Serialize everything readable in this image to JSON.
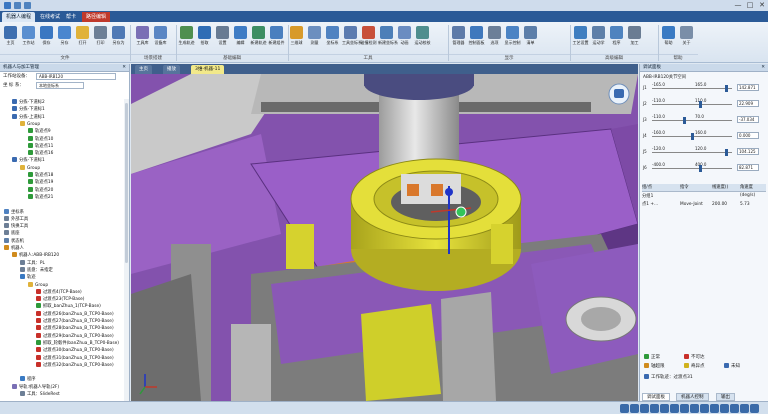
{
  "window": {
    "quick_access": [
      "save",
      "undo",
      "redo"
    ],
    "controls": [
      "—",
      "□",
      "✕"
    ]
  },
  "ribbon_tabs": [
    {
      "label": "机器人编程",
      "state": "active"
    },
    {
      "label": "在线考试",
      "state": "normal"
    },
    {
      "label": "帮卡",
      "state": "normal"
    },
    {
      "label": "路径编辑",
      "state": "ctx"
    }
  ],
  "ribbon": {
    "buttons": [
      {
        "label": "主页",
        "icon": "home-icon",
        "color": "#3e6fb0"
      },
      {
        "label": "工作站",
        "icon": "station-icon",
        "color": "#5b8fd0"
      },
      {
        "label": "保存",
        "icon": "save-icon",
        "color": "#3a77c2"
      },
      {
        "label": "另存",
        "icon": "save-as-icon",
        "color": "#4a86cf"
      },
      {
        "label": "打开",
        "icon": "open-icon",
        "color": "#e0b23a"
      },
      {
        "label": "打印",
        "icon": "print-icon",
        "color": "#6d7f96"
      },
      {
        "label": "另存为",
        "icon": "export-icon",
        "color": "#4f79b5"
      },
      {
        "label": "工具库",
        "icon": "tool-lib-icon",
        "color": "#7a6fb5"
      },
      {
        "label": "设备库",
        "icon": "device-lib-icon",
        "color": "#5a86c4"
      },
      {
        "label": "生成轨迹",
        "icon": "generate-path-icon",
        "color": "#4f8f4f"
      },
      {
        "label": "拾取",
        "icon": "pick-icon",
        "color": "#2f6db5"
      },
      {
        "label": "设置",
        "icon": "settings-icon",
        "color": "#687b93"
      },
      {
        "label": "编辑",
        "icon": "edit-icon",
        "color": "#3e7cc5"
      },
      {
        "label": "新建轨迹",
        "icon": "new-path-icon",
        "color": "#3d8e63"
      },
      {
        "label": "新建组件",
        "icon": "new-component-icon",
        "color": "#4a7fbf"
      },
      {
        "label": "三维球",
        "icon": "3d-ball-icon",
        "color": "#d89a2a"
      },
      {
        "label": "测量",
        "icon": "measure-icon",
        "color": "#6c8fbf"
      },
      {
        "label": "坐标系",
        "icon": "frame-icon",
        "color": "#4f82c1"
      },
      {
        "label": "工具坐标系",
        "icon": "tool-frame-icon",
        "color": "#5b7bb0"
      },
      {
        "label": "碰撞检测",
        "icon": "collision-icon",
        "color": "#c8503a"
      },
      {
        "label": "新建坐标系",
        "icon": "new-frame-icon",
        "color": "#4d7fb8"
      },
      {
        "label": "动画",
        "icon": "animation-icon",
        "color": "#6a8cc1"
      },
      {
        "label": "运动校核",
        "icon": "motion-check-icon",
        "color": "#4f8e8e"
      },
      {
        "label": "管理器",
        "icon": "manager-icon",
        "color": "#5d7aa8"
      },
      {
        "label": "控制面板",
        "icon": "control-panel-icon",
        "color": "#3f78bd"
      },
      {
        "label": "选项",
        "icon": "options-icon",
        "color": "#6c7f98"
      },
      {
        "label": "显示控制",
        "icon": "display-control-icon",
        "color": "#4b83c4"
      },
      {
        "label": "清单",
        "icon": "list-icon",
        "color": "#5c7ea9"
      },
      {
        "label": "工艺设置",
        "icon": "process-icon",
        "color": "#3f7ec0"
      },
      {
        "label": "运动学",
        "icon": "kinematics-icon",
        "color": "#5e7fa8"
      },
      {
        "label": "程序",
        "icon": "program-icon",
        "color": "#4f83bf"
      },
      {
        "label": "加工",
        "icon": "machining-icon",
        "color": "#6a7c93"
      },
      {
        "label": "帮助",
        "icon": "help-icon",
        "color": "#3a7ac3"
      },
      {
        "label": "关于",
        "icon": "about-icon",
        "color": "#7a8ea8"
      }
    ],
    "groups": [
      "文件",
      "场景搭建",
      "基础编辑",
      "工具",
      "显示",
      "高级编辑",
      "帮助"
    ]
  },
  "left_panel": {
    "title": "机器人与加工管理",
    "station_label": "工作站设备：",
    "station_value": "ABB-IRB120",
    "coord_label": "坐  标  系：",
    "coord_value": "本地坐标系",
    "tree": [
      {
        "text": "分拣-下道标2",
        "level": 1,
        "icon": "part-icon"
      },
      {
        "text": "分拣-下道标1",
        "level": 1,
        "icon": "part-icon"
      },
      {
        "text": "分拣-上道标1",
        "level": 1,
        "icon": "part-icon"
      },
      {
        "text": "Group",
        "level": 2,
        "icon": "folder-icon"
      },
      {
        "text": "轨迹点9",
        "level": 3,
        "icon": "check-icon"
      },
      {
        "text": "轨迹点10",
        "level": 3,
        "icon": "check-icon"
      },
      {
        "text": "轨迹点11",
        "level": 3,
        "icon": "check-icon"
      },
      {
        "text": "轨迹点16",
        "level": 3,
        "icon": "check-icon"
      },
      {
        "text": "分拣-下道标1",
        "level": 1,
        "icon": "part-icon"
      },
      {
        "text": "Group",
        "level": 2,
        "icon": "folder-icon"
      },
      {
        "text": "轨迹点18",
        "level": 3,
        "icon": "check-icon"
      },
      {
        "text": "轨迹点19",
        "level": 3,
        "icon": "check-icon"
      },
      {
        "text": "轨迹点20",
        "level": 3,
        "icon": "check-icon"
      },
      {
        "text": "轨迹点21",
        "level": 3,
        "icon": "check-icon"
      },
      {
        "text": "",
        "level": 0,
        "icon": ""
      },
      {
        "text": "坐标系",
        "level": 0,
        "icon": "frame-icon"
      },
      {
        "text": "外部工具",
        "level": 0,
        "icon": "tool-icon"
      },
      {
        "text": "快换工具",
        "level": 0,
        "icon": "tool-icon"
      },
      {
        "text": "底座",
        "level": 0,
        "icon": "base-icon"
      },
      {
        "text": "状态机",
        "level": 0,
        "icon": "state-icon"
      },
      {
        "text": "机器人",
        "level": 0,
        "icon": "robot-icon"
      },
      {
        "text": "机器人:ABB-IRB120",
        "level": 1,
        "icon": "robot-icon"
      },
      {
        "text": "工具：PL",
        "level": 2,
        "icon": "tool-icon"
      },
      {
        "text": "底盘：未指定",
        "level": 2,
        "icon": "base-icon"
      },
      {
        "text": "轨迹",
        "level": 2,
        "icon": "path-icon"
      },
      {
        "text": "Group",
        "level": 3,
        "icon": "folder-icon"
      },
      {
        "text": "过渡点4(TCP-Base)",
        "level": 4,
        "icon": "question-icon"
      },
      {
        "text": "过渡点23(TCP-Base)",
        "level": 4,
        "icon": "question-icon"
      },
      {
        "text": "抓取_banZhua_1(TCP-Base)",
        "level": 4,
        "icon": "check-icon"
      },
      {
        "text": "过渡点26(banZhua_B_TCP0-Base)",
        "level": 4,
        "icon": "question-icon"
      },
      {
        "text": "过渡点27(banZhua_B_TCP0-Base)",
        "level": 4,
        "icon": "question-icon"
      },
      {
        "text": "过渡点28(banZhua_B_TCP0-Base)",
        "level": 4,
        "icon": "question-icon"
      },
      {
        "text": "过渡点29(banZhua_B_TCP0-Base)",
        "level": 4,
        "icon": "question-icon"
      },
      {
        "text": "抓取_轮毂件(banZhua_B_TCP0-Base)",
        "level": 4,
        "icon": "check-icon"
      },
      {
        "text": "过渡点30(banZhua_B_TCP0-Base)",
        "level": 4,
        "icon": "question-icon"
      },
      {
        "text": "过渡点31(banZhua_B_TCP0-Base)",
        "level": 4,
        "icon": "question-icon"
      },
      {
        "text": "过渡点32(banZhua_B_TCP0-Base)",
        "level": 4,
        "icon": "question-icon"
      },
      {
        "text": "",
        "level": 0,
        "icon": ""
      },
      {
        "text": "程序",
        "level": 2,
        "icon": "program-icon"
      },
      {
        "text": "导轨:机器人导轨(2F)",
        "level": 1,
        "icon": "rail-icon"
      },
      {
        "text": "工具：SlideRest",
        "level": 2,
        "icon": "tool-icon"
      }
    ]
  },
  "viewport_tabs": [
    {
      "label": "主页",
      "state": "normal"
    },
    {
      "label": "播放",
      "state": "normal"
    },
    {
      "label": "3维-机器-11",
      "state": "active"
    }
  ],
  "right_panel": {
    "title": "调试面板",
    "robot_label": "ABB-IRB120关节空间",
    "joints": [
      {
        "name": "J1",
        "min": "-165.0",
        "max": "165.0",
        "cur": "165.0",
        "value": "142.871",
        "pos": 0.93
      },
      {
        "name": "J2",
        "min": "-110.0",
        "max": "110.0",
        "cur": "",
        "value": "22.909",
        "pos": 0.6
      },
      {
        "name": "J3",
        "min": "-110.0",
        "max": "70.0",
        "cur": "",
        "value": "-37.034",
        "pos": 0.4
      },
      {
        "name": "J4",
        "min": "-160.0",
        "max": "160.0",
        "cur": "",
        "value": "0.000",
        "pos": 0.5
      },
      {
        "name": "J5",
        "min": "-120.0",
        "max": "120.0",
        "cur": "",
        "value": "104.125",
        "pos": 0.93
      },
      {
        "name": "J6",
        "min": "-400.0",
        "max": "400.0",
        "cur": "",
        "value": "82.871",
        "pos": 0.6
      }
    ],
    "grid_headers": [
      "组/点",
      "指令",
      "线速度()",
      "角速度(deg/s)"
    ],
    "grid_rows": [
      {
        "c1": "分组1",
        "c2": "",
        "c3": "",
        "c4": ""
      },
      {
        "c1": "点1 +...",
        "c2": "Move-Joint",
        "c3": "200.00",
        "c4": "5.73"
      }
    ],
    "legend": [
      {
        "label": "正常",
        "icon": "check-icon",
        "color": "#2e9a3a"
      },
      {
        "label": "不可达",
        "icon": "cross-icon",
        "color": "#c8302a"
      },
      {
        "label": "轴超限",
        "icon": "axis-limit-icon",
        "color": "#d08b1d"
      },
      {
        "label": "奇异点",
        "icon": "singular-icon",
        "color": "#d0b21d"
      },
      {
        "label": "未知",
        "icon": "question-icon",
        "color": "#3a6ab0"
      }
    ],
    "current_track_label": "工作轨迹：过渡点31",
    "bottom_tabs": [
      {
        "label": "调试面板",
        "state": "active"
      },
      {
        "label": "机器人控制",
        "state": "normal"
      },
      {
        "label": "输出",
        "state": "normal"
      }
    ]
  },
  "status_icons": [
    "select-icon",
    "view-front-icon",
    "view-top-icon",
    "view-side-icon",
    "view-iso-icon",
    "zoom-icon",
    "fit-icon",
    "render-icon",
    "wire-icon",
    "shade-icon",
    "light-icon",
    "grid-icon",
    "snap-icon",
    "camera-icon"
  ],
  "colors": {
    "accent": "#2b5a97",
    "fixture_purple": "#7d4aa6",
    "part_yellow": "#d6d22e",
    "selection_blue": "#2145c4"
  }
}
